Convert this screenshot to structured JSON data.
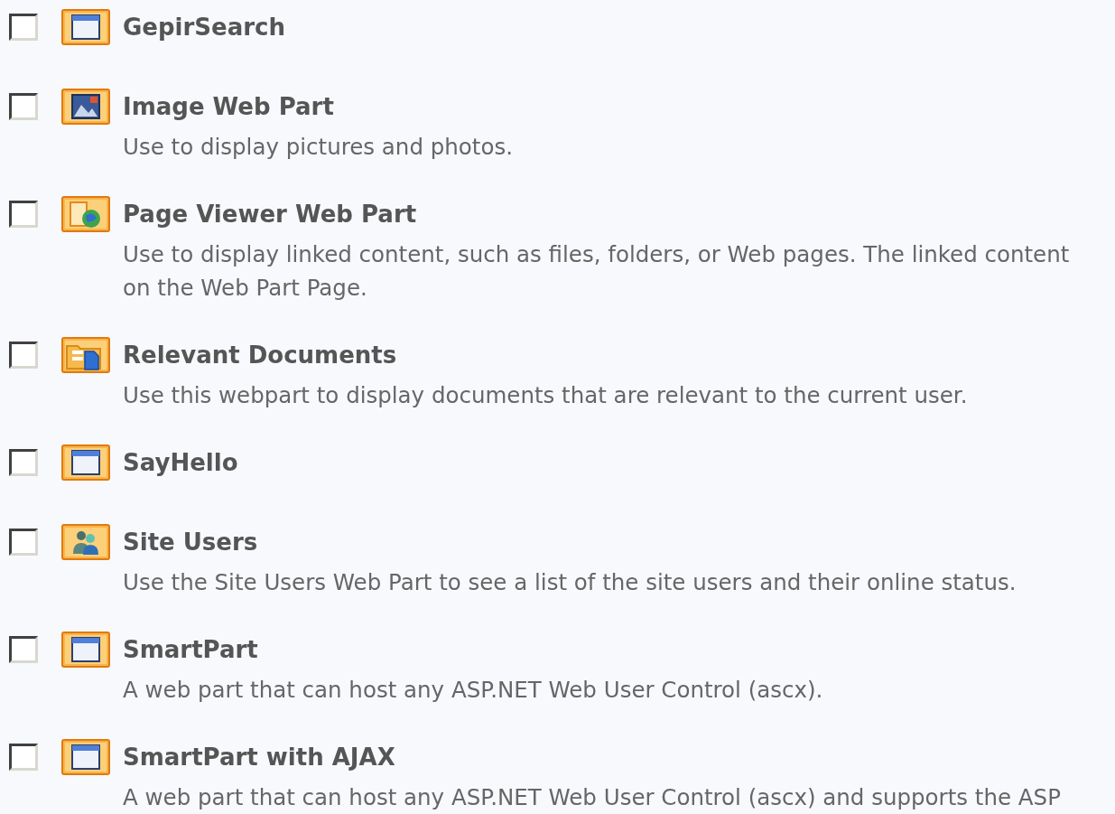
{
  "web_parts": [
    {
      "title": "GepirSearch",
      "checked": false
    },
    {
      "title": "Image Web Part",
      "checked": false,
      "description": [
        "Use to display pictures and photos."
      ]
    },
    {
      "title": "Page Viewer Web Part",
      "checked": false,
      "description": [
        "Use to display linked content, such as files, folders, or Web pages. The linked content",
        "on the Web Part Page."
      ]
    },
    {
      "title": "Relevant Documents",
      "checked": false,
      "description": [
        "Use this webpart to display documents that are relevant to the current user."
      ]
    },
    {
      "title": "SayHello",
      "checked": false
    },
    {
      "title": "Site Users",
      "checked": false,
      "description": [
        "Use the Site Users Web Part to see a list of the site users and their online status."
      ]
    },
    {
      "title": "SmartPart",
      "checked": false,
      "description": [
        "A web part that can host any ASP.NET Web User Control (ascx)."
      ]
    },
    {
      "title": "SmartPart with AJAX",
      "checked": false,
      "description": [
        "A web part that can host any ASP.NET Web User Control (ascx) and supports the ASP"
      ]
    }
  ]
}
